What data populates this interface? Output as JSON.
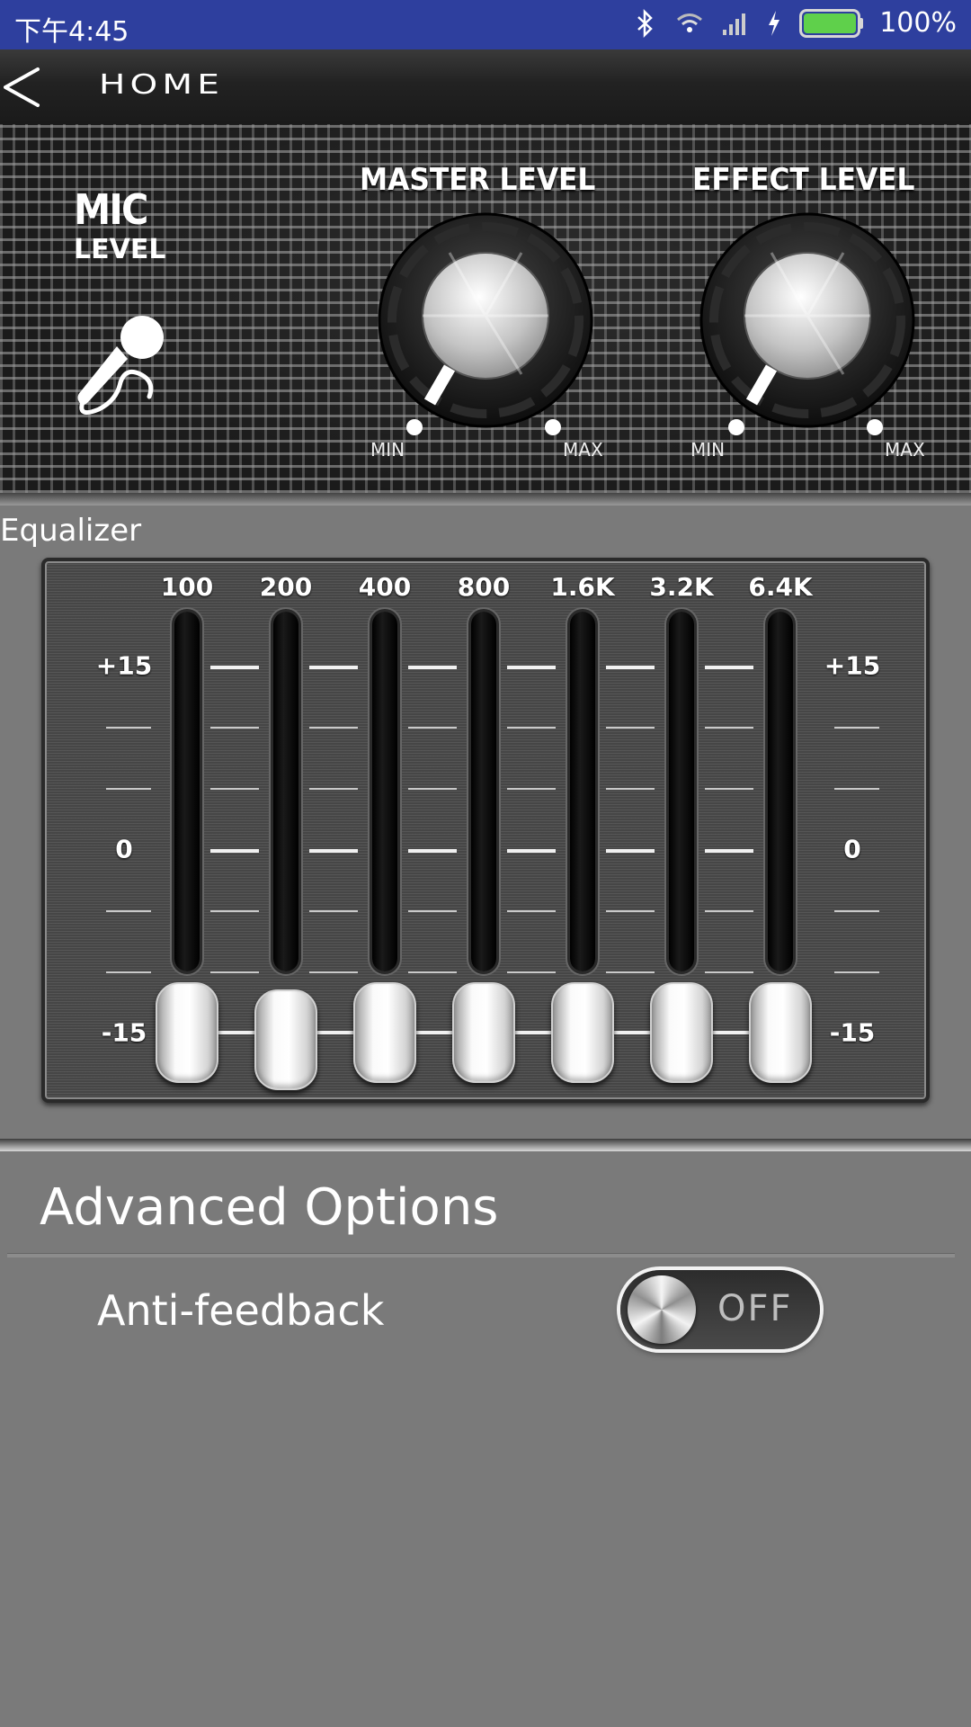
{
  "status_bar": {
    "time": "下午4:45",
    "battery_percent": "100%",
    "icons": [
      "bluetooth-icon",
      "wifi-icon",
      "signal-icon",
      "charging-icon",
      "battery-icon"
    ]
  },
  "app_bar": {
    "title": "HOME",
    "back_icon": "chevron-left-icon"
  },
  "mic": {
    "title": "MIC",
    "subtitle": "LEVEL",
    "icon": "microphone-icon"
  },
  "knobs": [
    {
      "label": "MASTER LEVEL",
      "min_label": "MIN",
      "max_label": "MAX",
      "level": 0
    },
    {
      "label": "EFFECT LEVEL",
      "min_label": "MIN",
      "max_label": "MAX",
      "level": 0
    }
  ],
  "equalizer": {
    "section_label": "Equalizer",
    "scale": {
      "top": "+15",
      "mid": "0",
      "bottom": "-15"
    },
    "bands": [
      {
        "freq": "100",
        "gain_db": -15
      },
      {
        "freq": "200",
        "gain_db": -15
      },
      {
        "freq": "400",
        "gain_db": -15
      },
      {
        "freq": "800",
        "gain_db": -15
      },
      {
        "freq": "1.6K",
        "gain_db": -15
      },
      {
        "freq": "3.2K",
        "gain_db": -15
      },
      {
        "freq": "6.4K",
        "gain_db": -15
      }
    ]
  },
  "advanced": {
    "title": "Advanced Options",
    "anti_feedback": {
      "label": "Anti-feedback",
      "state": "OFF"
    }
  }
}
